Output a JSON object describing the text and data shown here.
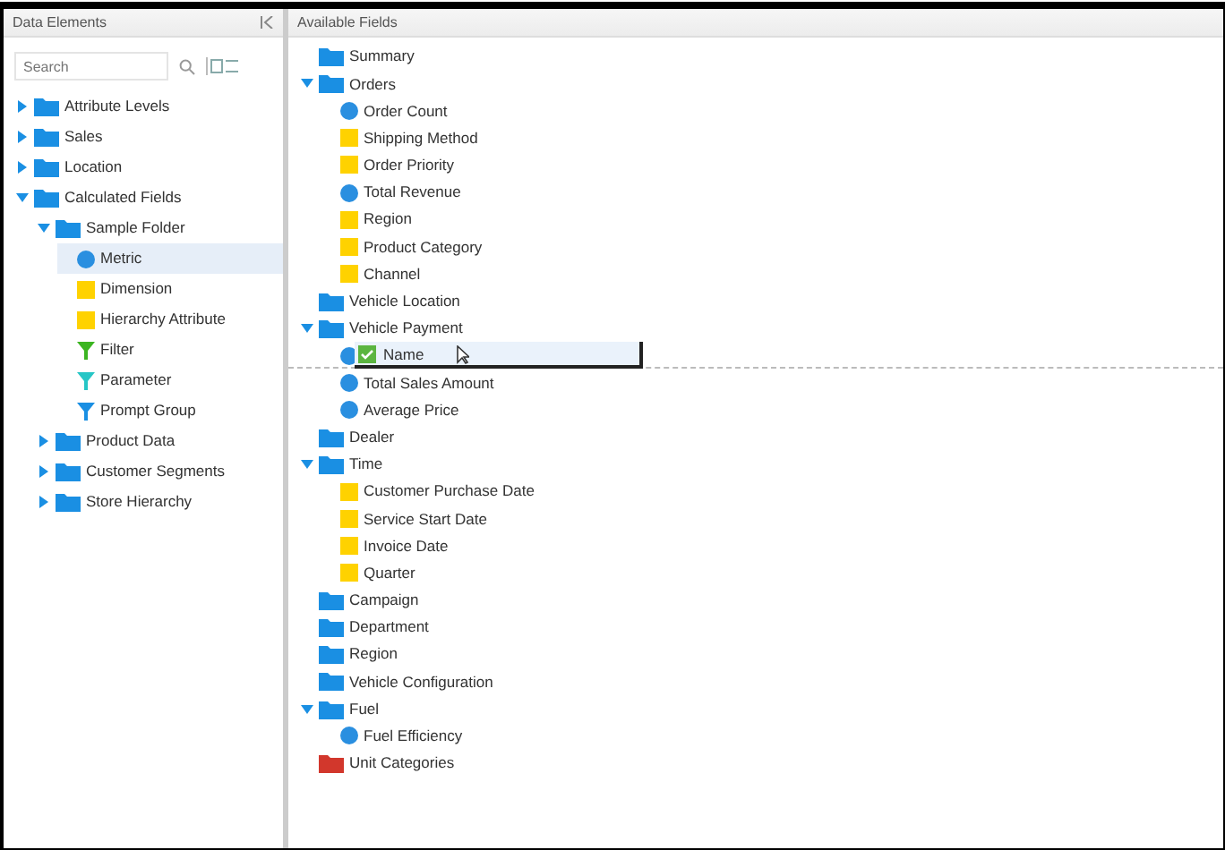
{
  "left_panel": {
    "title": "Data Elements",
    "search": {
      "placeholder": "Search"
    },
    "tree": [
      {
        "kind": "folder",
        "label": "Attribute Levels",
        "expanded": false,
        "selected": false
      },
      {
        "kind": "folder",
        "label": "Sales",
        "expanded": false,
        "selected": false
      },
      {
        "kind": "folder",
        "label": "Location",
        "expanded": false,
        "selected": false
      },
      {
        "kind": "folder",
        "label": "Calculated Fields",
        "expanded": true,
        "selected": false,
        "children": [
          {
            "kind": "folder",
            "label": "Sample Folder",
            "expanded": true,
            "selected": false,
            "children": [
              {
                "kind": "measure",
                "label": "Metric",
                "selected": true
              },
              {
                "kind": "attribute",
                "label": "Dimension",
                "selected": false
              },
              {
                "kind": "attribute",
                "label": "Hierarchy Attribute",
                "selected": false
              },
              {
                "kind": "filter",
                "label": "Filter",
                "color": "#3cb521",
                "selected": false
              },
              {
                "kind": "filter",
                "label": "Parameter",
                "color": "#26c6c6",
                "selected": false
              },
              {
                "kind": "filter",
                "label": "Prompt Group",
                "color": "#1a8fe3",
                "selected": false
              }
            ]
          },
          {
            "kind": "folder",
            "label": "Product Data",
            "expanded": false,
            "selected": false
          },
          {
            "kind": "folder",
            "label": "Customer Segments",
            "expanded": false,
            "selected": false
          },
          {
            "kind": "folder",
            "label": "Store Hierarchy",
            "expanded": false,
            "selected": false
          }
        ]
      }
    ]
  },
  "right_panel": {
    "title": "Available Fields",
    "tree": [
      {
        "kind": "folder",
        "label": "Summary",
        "selected": false
      },
      {
        "kind": "folder",
        "label": "Orders",
        "expanded": true,
        "selected": false,
        "children": [
          {
            "kind": "measure",
            "label": "Order Count",
            "selected": false
          },
          {
            "kind": "attribute",
            "label": "Shipping Method",
            "selected": false
          },
          {
            "kind": "attribute",
            "label": "Order Priority",
            "selected": false
          },
          {
            "kind": "measure",
            "label": "Total Revenue",
            "selected": false
          },
          {
            "kind": "attribute",
            "label": "Region",
            "selected": false
          },
          {
            "kind": "attribute",
            "label": "Product Category",
            "selected": false
          },
          {
            "kind": "attribute",
            "label": "Channel",
            "selected": false
          }
        ]
      },
      {
        "kind": "folder",
        "label": "Vehicle Location",
        "selected": false
      },
      {
        "kind": "folder",
        "label": "Vehicle Payment",
        "expanded": true,
        "selected": false,
        "children": [
          {
            "kind": "measure",
            "selected": false
          },
          {
            "kind": "measure",
            "label": "Total Sales Amount",
            "selected": false
          },
          {
            "kind": "measure",
            "label": "Average Price",
            "selected": false
          }
        ]
      },
      {
        "kind": "folder",
        "label": "Dealer",
        "selected": false
      },
      {
        "kind": "folder",
        "label": "Time",
        "expanded": true,
        "selected": false,
        "children": [
          {
            "kind": "attribute",
            "label": "Customer Purchase Date",
            "selected": false
          },
          {
            "kind": "attribute",
            "label": "Service Start Date",
            "selected": false
          },
          {
            "kind": "attribute",
            "label": "Invoice Date",
            "selected": false
          },
          {
            "kind": "attribute",
            "label": "Quarter",
            "selected": false
          }
        ]
      },
      {
        "kind": "folder",
        "label": "Campaign",
        "selected": false
      },
      {
        "kind": "folder",
        "label": "Department",
        "selected": false
      },
      {
        "kind": "folder",
        "label": "Region",
        "selected": false
      },
      {
        "kind": "folder",
        "label": "Vehicle Configuration",
        "selected": false
      },
      {
        "kind": "folder",
        "label": "Fuel",
        "expanded": true,
        "selected": false,
        "children": [
          {
            "kind": "measure",
            "label": "Fuel Efficiency",
            "selected": false
          }
        ]
      },
      {
        "kind": "category_folder",
        "label": "Unit Categories",
        "selected": false
      }
    ]
  },
  "drag": {
    "label": "Name"
  }
}
